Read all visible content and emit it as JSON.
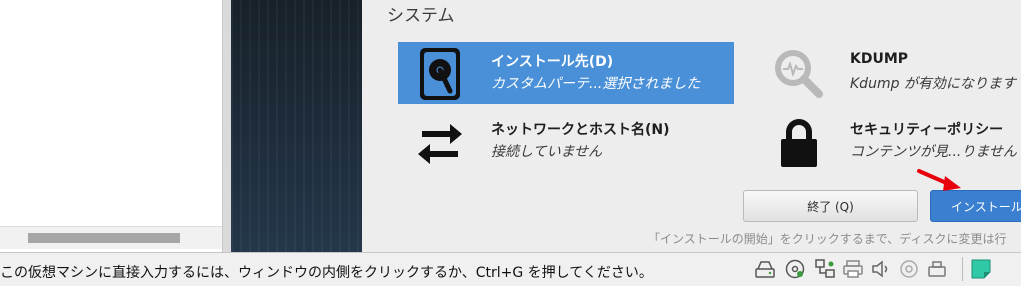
{
  "hub": {
    "section_title": "システム",
    "spokes": [
      {
        "title": "インストール先(D)",
        "status": "カスタムパーテ...選択されました",
        "icon": "harddisk-icon"
      },
      {
        "title": "KDUMP",
        "status": "Kdump が有効になります",
        "icon": "kdump-magnifier-icon"
      },
      {
        "title": "ネットワークとホスト名(N)",
        "status": "接続していません",
        "icon": "network-arrows-icon"
      },
      {
        "title": "セキュリティーポリシー",
        "status": "コンテンツが見...りません",
        "icon": "padlock-icon"
      }
    ],
    "quit_button": "終了 (Q)",
    "install_button": "インストール",
    "hint": "「インストールの開始」をクリックするまで、ディスクに変更は行"
  },
  "statusbar": {
    "message": "この仮想マシンに直接入力するには、ウィンドウの内側をクリックするか、Ctrl+G を押してください。",
    "icons": [
      "hdd-icon",
      "cd-icon",
      "network-icon",
      "printer-icon",
      "sound-icon",
      "usb-icon",
      "removable-device-icon",
      "note-icon"
    ]
  },
  "colors": {
    "selected_spoke": "#4a90d9",
    "install_button": "#3a7fd0",
    "annotation_arrow": "#e8000c"
  }
}
